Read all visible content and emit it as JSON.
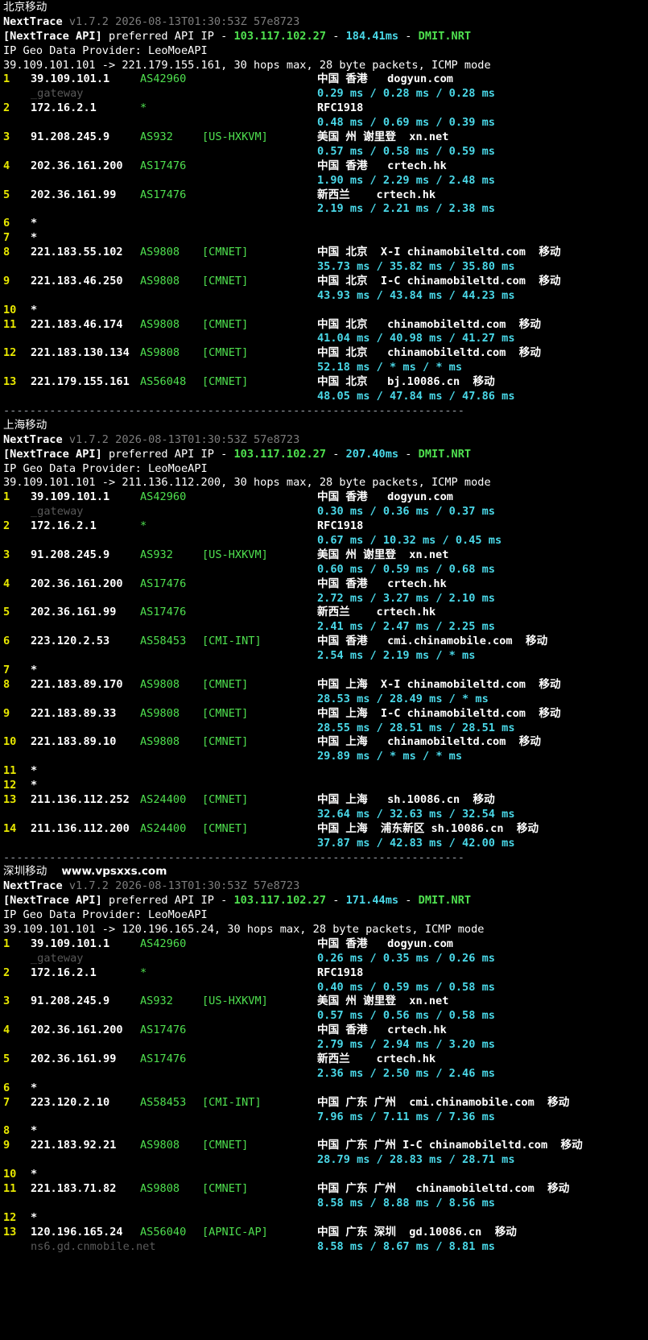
{
  "traces": [
    {
      "title": "北京移动",
      "header_app": "NextTrace",
      "header_version": "v1.7.2 2026-08-13T01:30:53Z 57e8723",
      "api_label": "[NextTrace API]",
      "api_text": " preferred API IP - ",
      "api_ip": "103.117.102.27",
      "api_sep": " - ",
      "api_ms": "184.41ms",
      "api_node": "DMIT.NRT",
      "geo_provider": "IP Geo Data Provider: LeoMoeAPI",
      "route": "39.109.101.101 -> 221.179.155.161, 30 hops max, 28 byte packets, ICMP mode",
      "hops": [
        {
          "n": "1",
          "ip": "39.109.101.1",
          "asn": "AS42960",
          "tag": "",
          "geo": "中国 香港   dogyun.com",
          "rtt": "0.29 ms / 0.28 ms / 0.28 ms",
          "gw": "_gateway"
        },
        {
          "n": "2",
          "ip": "172.16.2.1",
          "asn": "*",
          "tag": "",
          "geo": "RFC1918",
          "rtt": "0.48 ms / 0.69 ms / 0.39 ms"
        },
        {
          "n": "3",
          "ip": "91.208.245.9",
          "asn": "AS932",
          "tag": "[US-HXKVM]",
          "geo": "美国 州 谢里登  xn.net",
          "rtt": "0.57 ms / 0.58 ms / 0.59 ms"
        },
        {
          "n": "4",
          "ip": "202.36.161.200",
          "asn": "AS17476",
          "tag": "",
          "geo": "中国 香港   crtech.hk",
          "rtt": "1.90 ms / 2.29 ms / 2.48 ms"
        },
        {
          "n": "5",
          "ip": "202.36.161.99",
          "asn": "AS17476",
          "tag": "",
          "geo": "新西兰    crtech.hk",
          "rtt": "2.19 ms / 2.21 ms / 2.38 ms"
        },
        {
          "n": "6",
          "ip": "*",
          "asn": "",
          "tag": "",
          "geo": "",
          "rtt": ""
        },
        {
          "n": "7",
          "ip": "*",
          "asn": "",
          "tag": "",
          "geo": "",
          "rtt": ""
        },
        {
          "n": "8",
          "ip": "221.183.55.102",
          "asn": "AS9808",
          "tag": "[CMNET]",
          "geo": "中国 北京  X-I chinamobileltd.com  移动",
          "rtt": "35.73 ms / 35.82 ms / 35.80 ms"
        },
        {
          "n": "9",
          "ip": "221.183.46.250",
          "asn": "AS9808",
          "tag": "[CMNET]",
          "geo": "中国 北京  I-C chinamobileltd.com  移动",
          "rtt": "43.93 ms / 43.84 ms / 44.23 ms"
        },
        {
          "n": "10",
          "ip": "*",
          "asn": "",
          "tag": "",
          "geo": "",
          "rtt": ""
        },
        {
          "n": "11",
          "ip": "221.183.46.174",
          "asn": "AS9808",
          "tag": "[CMNET]",
          "geo": "中国 北京   chinamobileltd.com  移动",
          "rtt": "41.04 ms / 40.98 ms / 41.27 ms"
        },
        {
          "n": "12",
          "ip": "221.183.130.134",
          "asn": "AS9808",
          "tag": "[CMNET]",
          "geo": "中国 北京   chinamobileltd.com  移动",
          "rtt": "52.18 ms / * ms / * ms"
        },
        {
          "n": "13",
          "ip": "221.179.155.161",
          "asn": "AS56048",
          "tag": "[CMNET]",
          "geo": "中国 北京   bj.10086.cn  移动",
          "rtt": "48.05 ms / 47.84 ms / 47.86 ms"
        }
      ]
    },
    {
      "title": "上海移动",
      "header_app": "NextTrace",
      "header_version": "v1.7.2 2026-08-13T01:30:53Z 57e8723",
      "api_label": "[NextTrace API]",
      "api_text": " preferred API IP - ",
      "api_ip": "103.117.102.27",
      "api_sep": " - ",
      "api_ms": "207.40ms",
      "api_node": "DMIT.NRT",
      "geo_provider": "IP Geo Data Provider: LeoMoeAPI",
      "route": "39.109.101.101 -> 211.136.112.200, 30 hops max, 28 byte packets, ICMP mode",
      "hops": [
        {
          "n": "1",
          "ip": "39.109.101.1",
          "asn": "AS42960",
          "tag": "",
          "geo": "中国 香港   dogyun.com",
          "rtt": "0.30 ms / 0.36 ms / 0.37 ms",
          "gw": "_gateway"
        },
        {
          "n": "2",
          "ip": "172.16.2.1",
          "asn": "*",
          "tag": "",
          "geo": "RFC1918",
          "rtt": "0.67 ms / 10.32 ms / 0.45 ms"
        },
        {
          "n": "3",
          "ip": "91.208.245.9",
          "asn": "AS932",
          "tag": "[US-HXKVM]",
          "geo": "美国 州 谢里登  xn.net",
          "rtt": "0.60 ms / 0.59 ms / 0.68 ms"
        },
        {
          "n": "4",
          "ip": "202.36.161.200",
          "asn": "AS17476",
          "tag": "",
          "geo": "中国 香港   crtech.hk",
          "rtt": "2.72 ms / 3.27 ms / 2.10 ms"
        },
        {
          "n": "5",
          "ip": "202.36.161.99",
          "asn": "AS17476",
          "tag": "",
          "geo": "新西兰    crtech.hk",
          "rtt": "2.41 ms / 2.47 ms / 2.25 ms"
        },
        {
          "n": "6",
          "ip": "223.120.2.53",
          "asn": "AS58453",
          "tag": "[CMI-INT]",
          "geo": "中国 香港   cmi.chinamobile.com  移动",
          "rtt": "2.54 ms / 2.19 ms / * ms"
        },
        {
          "n": "7",
          "ip": "*",
          "asn": "",
          "tag": "",
          "geo": "",
          "rtt": ""
        },
        {
          "n": "8",
          "ip": "221.183.89.170",
          "asn": "AS9808",
          "tag": "[CMNET]",
          "geo": "中国 上海  X-I chinamobileltd.com  移动",
          "rtt": "28.53 ms / 28.49 ms / * ms"
        },
        {
          "n": "9",
          "ip": "221.183.89.33",
          "asn": "AS9808",
          "tag": "[CMNET]",
          "geo": "中国 上海  I-C chinamobileltd.com  移动",
          "rtt": "28.55 ms / 28.51 ms / 28.51 ms"
        },
        {
          "n": "10",
          "ip": "221.183.89.10",
          "asn": "AS9808",
          "tag": "[CMNET]",
          "geo": "中国 上海   chinamobileltd.com  移动",
          "rtt": "29.89 ms / * ms / * ms"
        },
        {
          "n": "11",
          "ip": "*",
          "asn": "",
          "tag": "",
          "geo": "",
          "rtt": ""
        },
        {
          "n": "12",
          "ip": "*",
          "asn": "",
          "tag": "",
          "geo": "",
          "rtt": ""
        },
        {
          "n": "13",
          "ip": "211.136.112.252",
          "asn": "AS24400",
          "tag": "[CMNET]",
          "geo": "中国 上海   sh.10086.cn  移动",
          "rtt": "32.64 ms / 32.63 ms / 32.54 ms"
        },
        {
          "n": "14",
          "ip": "211.136.112.200",
          "asn": "AS24400",
          "tag": "[CMNET]",
          "geo": "中国 上海  浦东新区 sh.10086.cn  移动",
          "rtt": "37.87 ms / 42.83 ms / 42.00 ms"
        }
      ]
    },
    {
      "title": "深圳移动",
      "watermark": "www.vpsxxs.com",
      "header_app": "NextTrace",
      "header_version": "v1.7.2 2026-08-13T01:30:53Z 57e8723",
      "api_label": "[NextTrace API]",
      "api_text": " preferred API IP - ",
      "api_ip": "103.117.102.27",
      "api_sep": " - ",
      "api_ms": "171.44ms",
      "api_node": "DMIT.NRT",
      "geo_provider": "IP Geo Data Provider: LeoMoeAPI",
      "route": "39.109.101.101 -> 120.196.165.24, 30 hops max, 28 byte packets, ICMP mode",
      "hops": [
        {
          "n": "1",
          "ip": "39.109.101.1",
          "asn": "AS42960",
          "tag": "",
          "geo": "中国 香港   dogyun.com",
          "rtt": "0.26 ms / 0.35 ms / 0.26 ms",
          "gw": "_gateway"
        },
        {
          "n": "2",
          "ip": "172.16.2.1",
          "asn": "*",
          "tag": "",
          "geo": "RFC1918",
          "rtt": "0.40 ms / 0.59 ms / 0.58 ms"
        },
        {
          "n": "3",
          "ip": "91.208.245.9",
          "asn": "AS932",
          "tag": "[US-HXKVM]",
          "geo": "美国 州 谢里登  xn.net",
          "rtt": "0.57 ms / 0.56 ms / 0.58 ms"
        },
        {
          "n": "4",
          "ip": "202.36.161.200",
          "asn": "AS17476",
          "tag": "",
          "geo": "中国 香港   crtech.hk",
          "rtt": "2.79 ms / 2.94 ms / 3.20 ms"
        },
        {
          "n": "5",
          "ip": "202.36.161.99",
          "asn": "AS17476",
          "tag": "",
          "geo": "新西兰    crtech.hk",
          "rtt": "2.36 ms / 2.50 ms / 2.46 ms"
        },
        {
          "n": "6",
          "ip": "*",
          "asn": "",
          "tag": "",
          "geo": "",
          "rtt": ""
        },
        {
          "n": "7",
          "ip": "223.120.2.10",
          "asn": "AS58453",
          "tag": "[CMI-INT]",
          "geo": "中国 广东 广州  cmi.chinamobile.com  移动",
          "rtt": "7.96 ms / 7.11 ms / 7.36 ms"
        },
        {
          "n": "8",
          "ip": "*",
          "asn": "",
          "tag": "",
          "geo": "",
          "rtt": ""
        },
        {
          "n": "9",
          "ip": "221.183.92.21",
          "asn": "AS9808",
          "tag": "[CMNET]",
          "geo": "中国 广东 广州 I-C chinamobileltd.com  移动",
          "rtt": "28.79 ms / 28.83 ms / 28.71 ms"
        },
        {
          "n": "10",
          "ip": "*",
          "asn": "",
          "tag": "",
          "geo": "",
          "rtt": ""
        },
        {
          "n": "11",
          "ip": "221.183.71.82",
          "asn": "AS9808",
          "tag": "[CMNET]",
          "geo": "中国 广东 广州   chinamobileltd.com  移动",
          "rtt": "8.58 ms / 8.88 ms / 8.56 ms"
        },
        {
          "n": "12",
          "ip": "*",
          "asn": "",
          "tag": "",
          "geo": "",
          "rtt": ""
        },
        {
          "n": "13",
          "ip": "120.196.165.24",
          "asn": "AS56040",
          "tag": "[APNIC-AP]",
          "geo": "中国 广东 深圳  gd.10086.cn  移动",
          "rtt": "8.58 ms / 8.67 ms / 8.81 ms",
          "gw": "ns6.gd.cnmobile.net"
        }
      ]
    }
  ],
  "separator": "----------------------------------------------------------------------"
}
